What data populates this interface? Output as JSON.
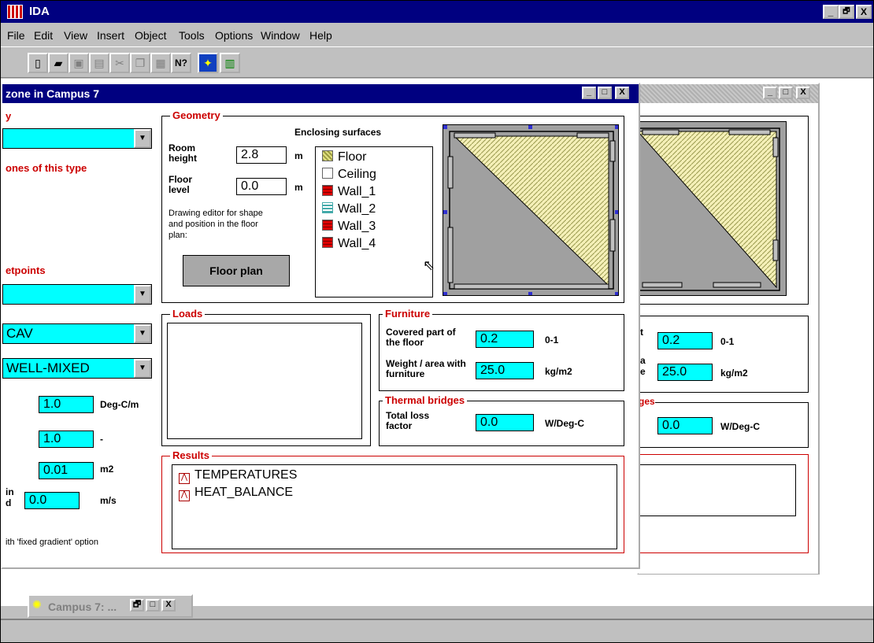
{
  "app": {
    "title": "IDA"
  },
  "menu": {
    "file": "File",
    "edit": "Edit",
    "view": "View",
    "insert": "Insert",
    "object": "Object",
    "tools": "Tools",
    "options": "Options",
    "window": "Window",
    "help": "Help"
  },
  "titlebar_buttons": {
    "min": "_",
    "max": "🗗",
    "close": "X"
  },
  "win_buttons": {
    "min": "_",
    "max": "□",
    "close": "X"
  },
  "toolbar": {
    "help_cursor": "N?"
  },
  "main": {
    "title": "zone in Campus 7"
  },
  "left": {
    "heading1": "y",
    "heading2": "ones of this type",
    "heading3": "etpoints",
    "cav": "CAV",
    "wellmixed": "WELL-MIXED",
    "f1": "1.0",
    "f1_unit": "Deg-C/m",
    "f2": "1.0",
    "f2_unit": "-",
    "f3": "0.01",
    "f3_unit": "m2",
    "f4_label_a": "in",
    "f4_label_b": "d",
    "f4": "0.0",
    "f4_unit": "m/s",
    "note": "ith 'fixed gradient' option"
  },
  "geometry": {
    "label": "Geometry",
    "room_height_label": "Room height",
    "room_height": "2.8",
    "floor_level_label": "Floor level",
    "floor_level": "0.0",
    "unit_m": "m",
    "drawing_note": "Drawing editor for shape and position in the floor plan:",
    "floor_plan_button": "Floor plan",
    "enclosing_label": "Enclosing surfaces",
    "surfaces": [
      "Floor",
      "Ceiling",
      "Wall_1",
      "Wall_2",
      "Wall_3",
      "Wall_4"
    ]
  },
  "loads": {
    "label": "Loads"
  },
  "furniture": {
    "label": "Furniture",
    "covered_label": "Covered part of the floor",
    "covered": "0.2",
    "covered_unit": "0-1",
    "weight_label": "Weight / area with furniture",
    "weight": "25.0",
    "weight_unit": "kg/m2"
  },
  "thermal": {
    "label": "Thermal bridges",
    "loss_label": "Total loss factor",
    "loss": "0.0",
    "loss_unit": "W/Deg-C"
  },
  "results": {
    "label": "Results",
    "items": [
      "TEMPERATURES",
      "HEAT_BALANCE"
    ]
  },
  "back": {
    "t_label": "t",
    "covered": "0.2",
    "covered_unit": "0-1",
    "a_label": "a",
    "e_label": "e",
    "weight": "25.0",
    "weight_unit": "kg/m2",
    "ges_label": "ges",
    "loss": "0.0",
    "loss_unit": "W/Deg-C"
  },
  "taskbar": {
    "label": "Campus 7: ..."
  },
  "colors": {
    "titlebar": "#000080",
    "field": "#00ffff",
    "group_label": "#cc0000",
    "face": "#c0c0c0"
  }
}
